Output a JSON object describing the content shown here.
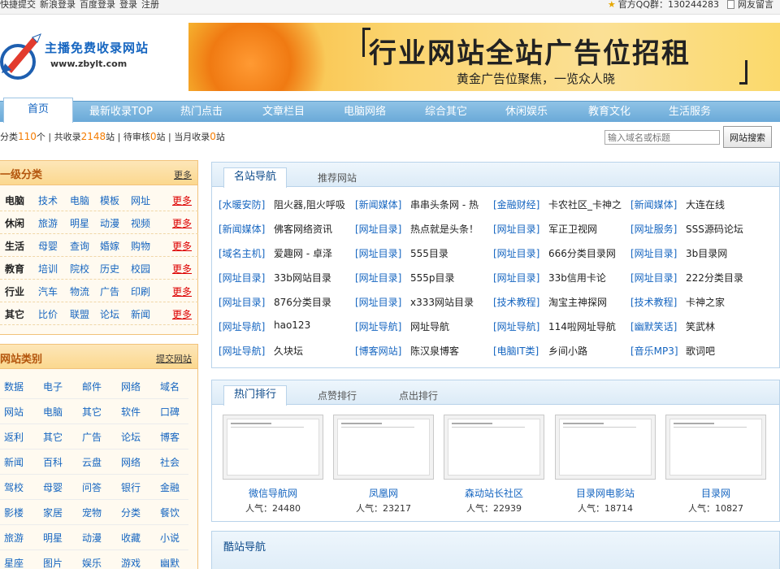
{
  "topbar": {
    "links": [
      "快捷提交",
      "新浪登录",
      "百度登录",
      "登录",
      "注册"
    ],
    "qq_group": "官方QQ群：130244283",
    "feedback": "网友留言"
  },
  "logo": {
    "name": "主播免费收录网站",
    "url": "www.zbylt.com"
  },
  "banner": {
    "headline": "行业网站全站广告位招租",
    "subline": "黄金广告位聚焦，一览众人晓"
  },
  "nav": {
    "home": "首页",
    "items": [
      "最新收录TOP",
      "热门点击",
      "文章栏目",
      "电脑网络",
      "综合其它",
      "休闲娱乐",
      "教育文化",
      "生活服务"
    ]
  },
  "stats": {
    "p1": "分类",
    "categories": "110",
    "p2": "个 | 共收录",
    "total": "2148",
    "p3": "站 | 待审核",
    "pending": "0",
    "p4": "站 | 当月收录",
    "month": "0",
    "p5": "站"
  },
  "search": {
    "placeholder": "输入域名或标题",
    "button": "网站搜索"
  },
  "category_panel": {
    "title": "一级分类",
    "more": "更多",
    "rows": [
      {
        "main": "电脑",
        "subs": [
          "技术",
          "电脑",
          "模板",
          "网址"
        ],
        "more": "更多"
      },
      {
        "main": "休闲",
        "subs": [
          "旅游",
          "明星",
          "动漫",
          "视频"
        ],
        "more": "更多"
      },
      {
        "main": "生活",
        "subs": [
          "母婴",
          "查询",
          "婚嫁",
          "购物"
        ],
        "more": "更多"
      },
      {
        "main": "教育",
        "subs": [
          "培训",
          "院校",
          "历史",
          "校园"
        ],
        "more": "更多"
      },
      {
        "main": "行业",
        "subs": [
          "汽车",
          "物流",
          "广告",
          "印刷"
        ],
        "more": "更多"
      },
      {
        "main": "其它",
        "subs": [
          "比价",
          "联盟",
          "论坛",
          "新闻"
        ],
        "more": "更多"
      }
    ]
  },
  "type_panel": {
    "title": "网站类别",
    "submit": "提交网站",
    "rows": [
      [
        "数据",
        "电子",
        "邮件",
        "网络",
        "域名"
      ],
      [
        "网站",
        "电脑",
        "其它",
        "软件",
        "口碑"
      ],
      [
        "返利",
        "其它",
        "广告",
        "论坛",
        "博客"
      ],
      [
        "新闻",
        "百科",
        "云盘",
        "网络",
        "社会"
      ],
      [
        "驾校",
        "母婴",
        "问答",
        "银行",
        "金融"
      ],
      [
        "影楼",
        "家居",
        "宠物",
        "分类",
        "餐饮"
      ],
      [
        "旅游",
        "明星",
        "动漫",
        "收藏",
        "小说"
      ],
      [
        "星座",
        "图片",
        "娱乐",
        "游戏",
        "幽默"
      ]
    ]
  },
  "famous_box": {
    "tabs": [
      "名站导航",
      "推荐网站"
    ],
    "rows": [
      [
        [
          "[水暖安防]",
          "阻火器,阻火呼吸"
        ],
        [
          "[新闻媒体]",
          "串串头条网 - 热"
        ],
        [
          "[金融财经]",
          "卡农社区_卡神之"
        ],
        [
          "[新闻媒体]",
          "大连在线"
        ]
      ],
      [
        [
          "[新闻媒体]",
          "佛客网络资讯"
        ],
        [
          "[网址目录]",
          "热点就是头条！"
        ],
        [
          "[网址目录]",
          "军正卫视网"
        ],
        [
          "[网址服务]",
          "SSS源码论坛"
        ]
      ],
      [
        [
          "[域名主机]",
          "爱趣网 - 卓泽"
        ],
        [
          "[网址目录]",
          "555目录"
        ],
        [
          "[网址目录]",
          "666分类目录网"
        ],
        [
          "[网址目录]",
          "3b目录网"
        ]
      ],
      [
        [
          "[网址目录]",
          "33b网站目录"
        ],
        [
          "[网址目录]",
          "555p目录"
        ],
        [
          "[网址目录]",
          "33b信用卡论"
        ],
        [
          "[网址目录]",
          "222分类目录"
        ]
      ],
      [
        [
          "[网址目录]",
          "876分类目录"
        ],
        [
          "[网址目录]",
          "x333网站目录"
        ],
        [
          "[技术教程]",
          "淘宝主神探网"
        ],
        [
          "[技术教程]",
          "卡神之家"
        ]
      ],
      [
        [
          "[网址导航]",
          "hao123"
        ],
        [
          "[网址导航]",
          "网址导航"
        ],
        [
          "[网址导航]",
          "114啦网址导航"
        ],
        [
          "[幽默笑话]",
          "笑武林"
        ]
      ],
      [
        [
          "[网址导航]",
          "久块坛"
        ],
        [
          "[博客网站]",
          "陈汉泉博客"
        ],
        [
          "[电脑IT类]",
          "乡间小路"
        ],
        [
          "[音乐MP3]",
          "歌词吧"
        ]
      ]
    ]
  },
  "hot_box": {
    "tabs": [
      "热门排行",
      "点赞排行",
      "点出排行"
    ],
    "sites": [
      {
        "name": "微信导航网",
        "pop": "人气：24480"
      },
      {
        "name": "凤凰网",
        "pop": "人气：23217"
      },
      {
        "name": "森动站长社区",
        "pop": "人气：22939"
      },
      {
        "name": "目录网电影站",
        "pop": "人气：18714"
      },
      {
        "name": "目录网",
        "pop": "人气：10827"
      }
    ]
  },
  "cool_box": {
    "title": "酷站导航"
  },
  "colors": {
    "accent": "#1565c0",
    "nav": "#6aa9d8",
    "highlight": "#f57c00",
    "panel_border": "#f2c27a"
  }
}
